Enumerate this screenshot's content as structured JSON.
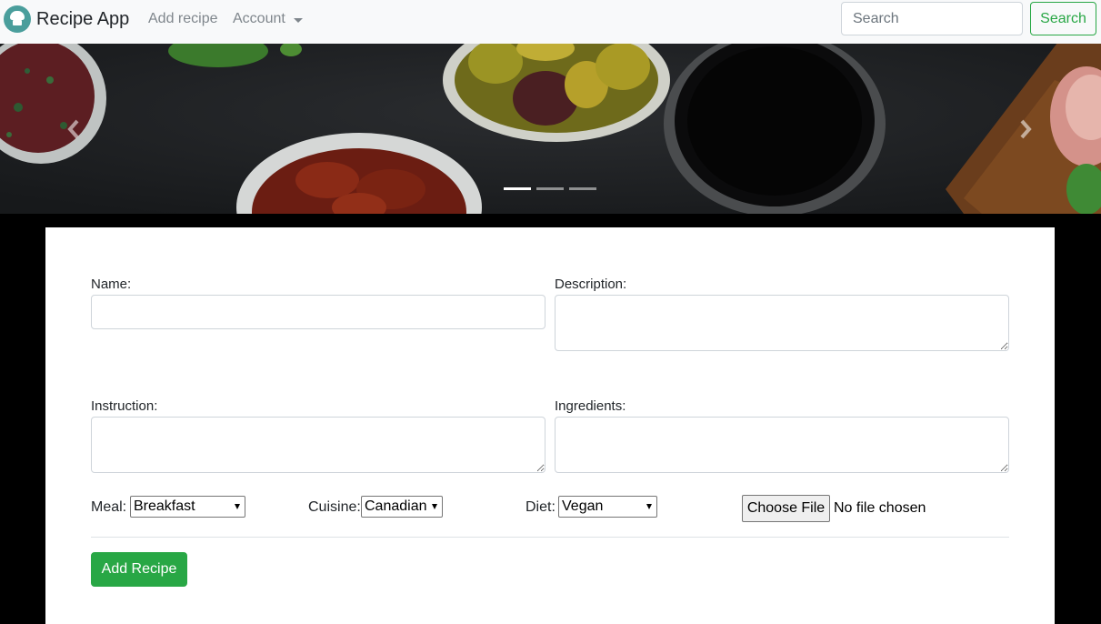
{
  "navbar": {
    "brand": "Recipe App",
    "logo_icon": "chef-hat-icon",
    "links": {
      "add_recipe": "Add recipe",
      "account": "Account"
    },
    "search": {
      "placeholder": "Search",
      "button_label": "Search"
    }
  },
  "carousel": {
    "slide_count": 3,
    "active_index": 0,
    "prev_icon": "chevron-left-icon",
    "next_icon": "chevron-right-icon"
  },
  "form": {
    "name_label": "Name:",
    "description_label": "Description:",
    "instruction_label": "Instruction:",
    "ingredients_label": "Ingredients:",
    "meal": {
      "label": "Meal:",
      "value": "Breakfast"
    },
    "cuisine": {
      "label": "Cuisine:",
      "value": "Canadian"
    },
    "diet": {
      "label": "Diet:",
      "value": "Vegan"
    },
    "file": {
      "button_label": "Choose File",
      "status": "No file chosen"
    },
    "submit_label": "Add Recipe"
  },
  "colors": {
    "navbar_bg": "#f8f9fa",
    "success": "#28a745",
    "nav_link": "#7f868c",
    "page_bg": "#000000"
  }
}
